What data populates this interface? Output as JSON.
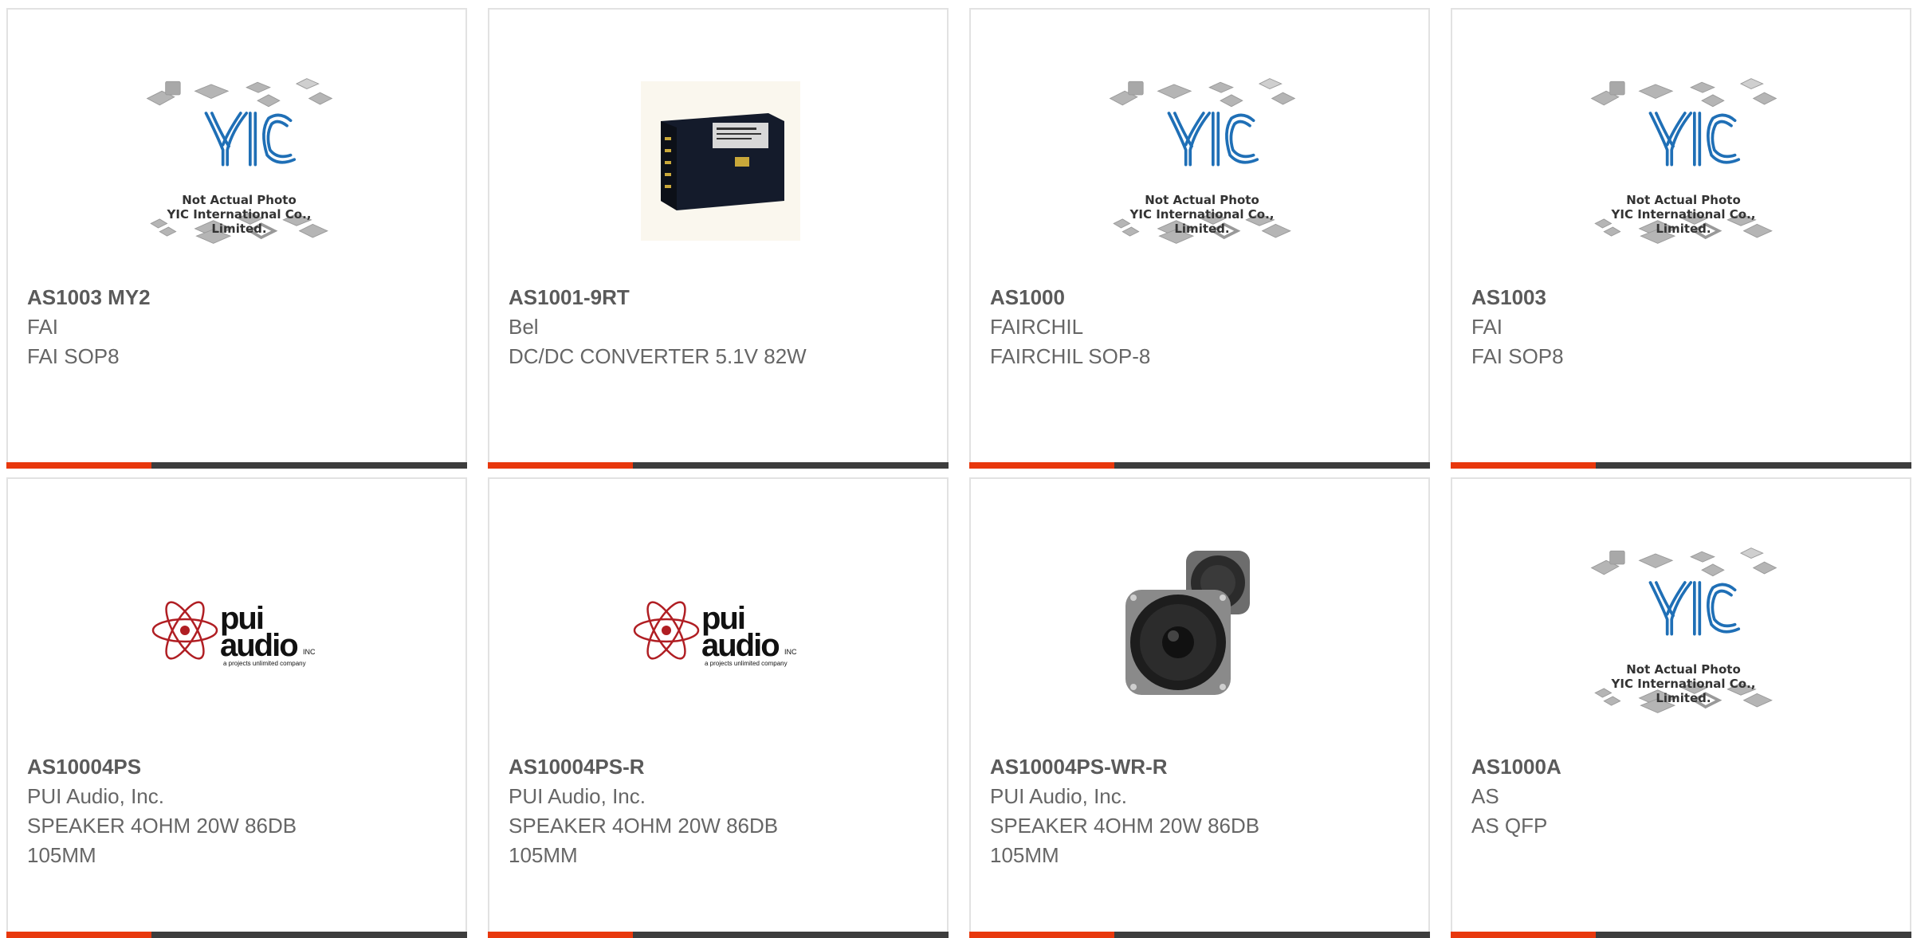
{
  "colors": {
    "accent": "#e8380d",
    "bar": "#3d3d3d",
    "border": "#e2e2e2",
    "text": "#666666"
  },
  "placeholder": {
    "brand": "YIC",
    "line1": "Not Actual Photo",
    "line2": "YIC International Co., Limited."
  },
  "pui_logo": {
    "line1": "pui",
    "line2": "audio",
    "suffix": "INC",
    "tagline": "a projects unlimited company"
  },
  "products": [
    {
      "part": "AS1003 MY2",
      "maker": "FAI",
      "desc": "FAI SOP8",
      "image": "placeholder-icon"
    },
    {
      "part": "AS1001-9RT",
      "maker": "Bel",
      "desc": "DC/DC CONVERTER 5.1V 82W",
      "image": "converter-photo"
    },
    {
      "part": "AS1000",
      "maker": "FAIRCHIL",
      "desc": "FAIRCHIL SOP-8",
      "image": "placeholder-icon"
    },
    {
      "part": "AS1003",
      "maker": "FAI",
      "desc": "FAI SOP8",
      "image": "placeholder-icon"
    },
    {
      "part": "AS10004PS",
      "maker": "PUI Audio, Inc.",
      "desc": "SPEAKER 4OHM 20W 86DB",
      "desc2": "105MM",
      "image": "pui-audio-logo"
    },
    {
      "part": "AS10004PS-R",
      "maker": "PUI Audio, Inc.",
      "desc": "SPEAKER 4OHM 20W 86DB",
      "desc2": "105MM",
      "image": "pui-audio-logo"
    },
    {
      "part": "AS10004PS-WR-R",
      "maker": "PUI Audio, Inc.",
      "desc": "SPEAKER 4OHM 20W 86DB",
      "desc2": "105MM",
      "image": "speaker-photo"
    },
    {
      "part": "AS1000A",
      "maker": "AS",
      "desc": "AS QFP",
      "image": "placeholder-icon"
    }
  ]
}
